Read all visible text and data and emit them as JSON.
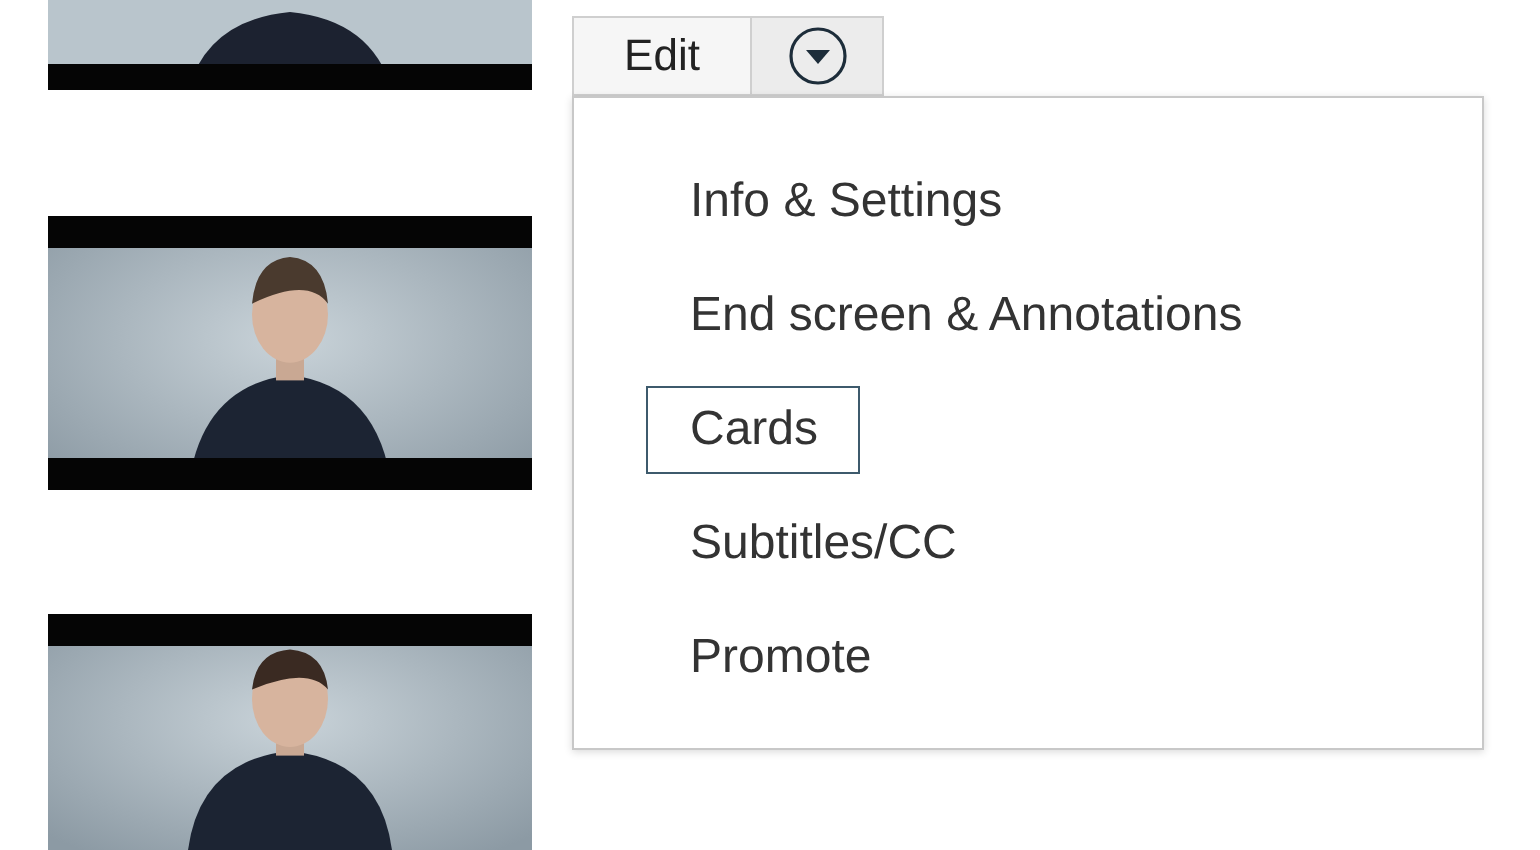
{
  "edit_button": {
    "label": "Edit"
  },
  "dropdown": {
    "expanded": true,
    "items": [
      {
        "label": "Info & Settings",
        "selected": false
      },
      {
        "label": "End screen & Annotations",
        "selected": false
      },
      {
        "label": "Cards",
        "selected": true
      },
      {
        "label": "Subtitles/CC",
        "selected": false
      },
      {
        "label": "Promote",
        "selected": false
      }
    ]
  }
}
